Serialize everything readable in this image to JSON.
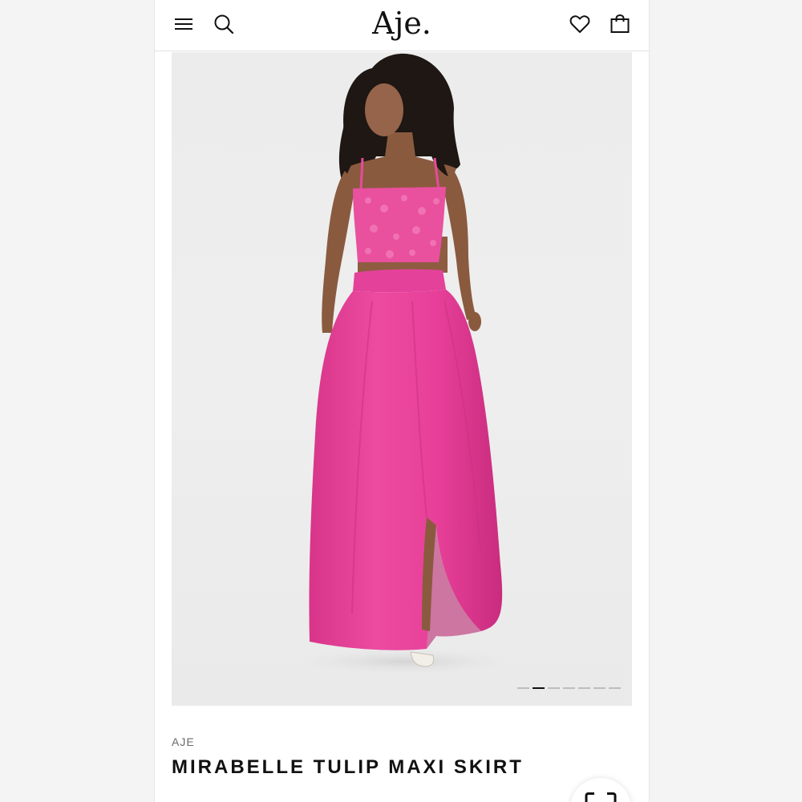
{
  "header": {
    "logo": "Aje.",
    "menu_icon": "hamburger-menu-icon",
    "search_icon": "search-icon",
    "wishlist_icon": "heart-icon",
    "bag_icon": "shopping-bag-icon"
  },
  "gallery": {
    "image_alt": "Model wearing pink sequin crop top and pink maxi skirt",
    "slide_count": 7,
    "active_slide": 2
  },
  "product": {
    "brand": "AJE",
    "name": "MIRABELLE TULIP MAXI SKIRT"
  },
  "floating": {
    "icon": "scan-icon"
  },
  "colors": {
    "skirt": "#e8409a",
    "background": "#ececec",
    "text": "#111111"
  }
}
